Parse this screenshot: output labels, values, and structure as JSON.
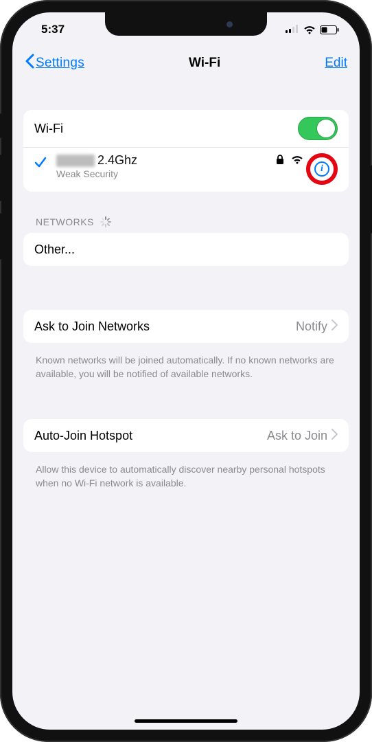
{
  "status": {
    "time": "5:37"
  },
  "nav": {
    "back": "Settings",
    "title": "Wi-Fi",
    "edit": "Edit"
  },
  "wifi_section": {
    "wifi_label": "Wi-Fi",
    "toggle_on": true,
    "connected": {
      "name_suffix": "2.4Ghz",
      "subtitle": "Weak Security"
    }
  },
  "networks": {
    "header": "NETWORKS",
    "other": "Other..."
  },
  "ask_join": {
    "label": "Ask to Join Networks",
    "value": "Notify",
    "footer": "Known networks will be joined automatically. If no known networks are available, you will be notified of available networks."
  },
  "auto_hotspot": {
    "label": "Auto-Join Hotspot",
    "value": "Ask to Join",
    "footer": "Allow this device to automatically discover nearby personal hotspots when no Wi-Fi network is available."
  }
}
